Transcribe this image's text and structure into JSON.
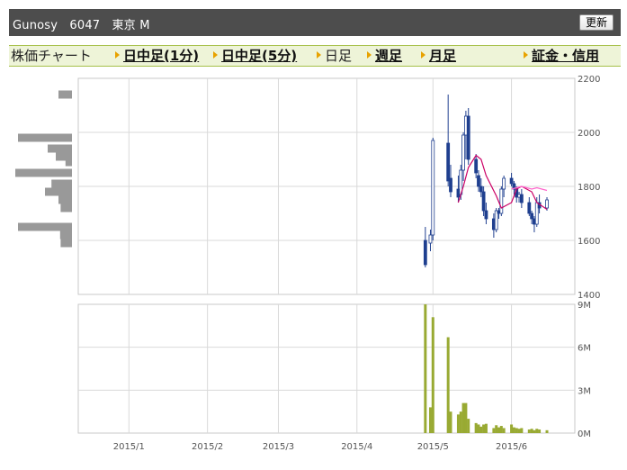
{
  "header": {
    "title": "Gunosy　6047　東京 M",
    "refresh_label": "更新"
  },
  "nav": {
    "items": [
      {
        "label": "株価チャート",
        "link": false,
        "arrow": false
      },
      {
        "label": "日中足(1分)",
        "link": true,
        "arrow": true
      },
      {
        "label": "日中足(5分)",
        "link": true,
        "arrow": true
      },
      {
        "label": "日足",
        "link": false,
        "arrow": true
      },
      {
        "label": "週足",
        "link": true,
        "arrow": true
      },
      {
        "label": "月足",
        "link": true,
        "arrow": true
      },
      {
        "label": "証金・信用",
        "link": true,
        "arrow": true
      }
    ]
  },
  "colors": {
    "up": "#ffffff",
    "down": "#1f3f8f",
    "wick": "#1f3f8f",
    "ma": "#cc0066",
    "ma2": "#ff66cc",
    "volume": "#99aa33",
    "profile": "#999999",
    "grid": "#d9d9d9"
  },
  "chart_data": [
    {
      "type": "candlestick",
      "title": "",
      "y_ticks": [
        "2200",
        "2000",
        "1800",
        "1600",
        "1400"
      ],
      "y_tick_values": [
        2200,
        2000,
        1800,
        1600,
        1400
      ],
      "ylim": [
        1400,
        2200
      ],
      "x_ticks": [
        "2015/1",
        "2015/2",
        "2015/3",
        "2015/4",
        "2015/5",
        "2015/6"
      ],
      "date_range": [
        "2014-12-12",
        "2015-06-26"
      ],
      "grid": true,
      "ohlc": [
        [
          "2015-04-28",
          1600,
          1650,
          1500,
          1510
        ],
        [
          "2015-04-30",
          1590,
          1640,
          1560,
          1620
        ],
        [
          "2015-05-01",
          1620,
          1980,
          1600,
          1970
        ],
        [
          "2015-05-07",
          1960,
          2140,
          1800,
          1820
        ],
        [
          "2015-05-08",
          1830,
          1880,
          1760,
          1780
        ],
        [
          "2015-05-11",
          1790,
          1840,
          1740,
          1760
        ],
        [
          "2015-05-12",
          1770,
          1880,
          1750,
          1860
        ],
        [
          "2015-05-13",
          1860,
          2000,
          1820,
          1990
        ],
        [
          "2015-05-14",
          1990,
          2080,
          1900,
          2060
        ],
        [
          "2015-05-15",
          2060,
          2090,
          1880,
          1900
        ],
        [
          "2015-05-18",
          1900,
          1920,
          1830,
          1850
        ],
        [
          "2015-05-19",
          1840,
          1860,
          1780,
          1800
        ],
        [
          "2015-05-20",
          1800,
          1830,
          1760,
          1780
        ],
        [
          "2015-05-21",
          1780,
          1800,
          1690,
          1710
        ],
        [
          "2015-05-22",
          1710,
          1740,
          1660,
          1680
        ],
        [
          "2015-05-25",
          1680,
          1700,
          1610,
          1640
        ],
        [
          "2015-05-26",
          1640,
          1720,
          1630,
          1710
        ],
        [
          "2015-05-27",
          1710,
          1720,
          1680,
          1700
        ],
        [
          "2015-05-28",
          1700,
          1800,
          1690,
          1790
        ],
        [
          "2015-05-29",
          1790,
          1840,
          1760,
          1830
        ],
        [
          "2015-06-01",
          1830,
          1850,
          1800,
          1810
        ],
        [
          "2015-06-02",
          1810,
          1820,
          1770,
          1790
        ],
        [
          "2015-06-03",
          1790,
          1800,
          1740,
          1760
        ],
        [
          "2015-06-04",
          1760,
          1780,
          1740,
          1770
        ],
        [
          "2015-06-05",
          1770,
          1790,
          1720,
          1740
        ],
        [
          "2015-06-08",
          1740,
          1760,
          1690,
          1700
        ],
        [
          "2015-06-09",
          1700,
          1710,
          1660,
          1680
        ],
        [
          "2015-06-10",
          1680,
          1690,
          1630,
          1660
        ],
        [
          "2015-06-11",
          1660,
          1760,
          1650,
          1740
        ],
        [
          "2015-06-12",
          1740,
          1770,
          1700,
          1720
        ],
        [
          "2015-06-15",
          1720,
          1760,
          1710,
          1750
        ]
      ],
      "moving_average_1": [
        [
          "2015-05-11",
          1740
        ],
        [
          "2015-05-13",
          1800
        ],
        [
          "2015-05-15",
          1870
        ],
        [
          "2015-05-18",
          1915
        ],
        [
          "2015-05-20",
          1900
        ],
        [
          "2015-05-22",
          1840
        ],
        [
          "2015-05-26",
          1765
        ],
        [
          "2015-05-28",
          1720
        ],
        [
          "2015-06-01",
          1740
        ],
        [
          "2015-06-03",
          1790
        ],
        [
          "2015-06-05",
          1800
        ],
        [
          "2015-06-09",
          1780
        ],
        [
          "2015-06-11",
          1740
        ],
        [
          "2015-06-15",
          1715
        ]
      ],
      "moving_average_2": [
        [
          "2015-06-01",
          1790
        ],
        [
          "2015-06-05",
          1800
        ],
        [
          "2015-06-09",
          1790
        ],
        [
          "2015-06-11",
          1795
        ],
        [
          "2015-06-15",
          1785
        ]
      ],
      "volume_by_price": [
        [
          2140,
          0.25
        ],
        [
          1980,
          1.0
        ],
        [
          1940,
          0.45
        ],
        [
          1910,
          0.3
        ],
        [
          1890,
          0.12
        ],
        [
          1850,
          1.05
        ],
        [
          1810,
          0.38
        ],
        [
          1780,
          0.5
        ],
        [
          1750,
          0.25
        ],
        [
          1720,
          0.21
        ],
        [
          1650,
          1.0
        ],
        [
          1620,
          0.22
        ],
        [
          1590,
          0.21
        ]
      ]
    },
    {
      "type": "bar",
      "title": "",
      "y_ticks": [
        "9M",
        "6M",
        "3M",
        "0M"
      ],
      "y_tick_values": [
        9,
        6,
        3,
        0
      ],
      "unit": "M",
      "ylim": [
        0,
        9
      ],
      "grid": true,
      "x_ticks": [
        "2015/1",
        "2015/2",
        "2015/3",
        "2015/4",
        "2015/5",
        "2015/6"
      ],
      "volumes": [
        [
          "2015-04-28",
          9.0
        ],
        [
          "2015-04-30",
          1.8
        ],
        [
          "2015-05-01",
          8.1
        ],
        [
          "2015-05-07",
          6.7
        ],
        [
          "2015-05-08",
          1.5
        ],
        [
          "2015-05-11",
          1.3
        ],
        [
          "2015-05-12",
          1.5
        ],
        [
          "2015-05-13",
          2.1
        ],
        [
          "2015-05-14",
          2.1
        ],
        [
          "2015-05-15",
          1.0
        ],
        [
          "2015-05-18",
          0.7
        ],
        [
          "2015-05-19",
          0.6
        ],
        [
          "2015-05-20",
          0.45
        ],
        [
          "2015-05-21",
          0.6
        ],
        [
          "2015-05-22",
          0.65
        ],
        [
          "2015-05-25",
          0.35
        ],
        [
          "2015-05-26",
          0.55
        ],
        [
          "2015-05-27",
          0.4
        ],
        [
          "2015-05-28",
          0.5
        ],
        [
          "2015-05-29",
          0.35
        ],
        [
          "2015-06-01",
          0.6
        ],
        [
          "2015-06-02",
          0.4
        ],
        [
          "2015-06-03",
          0.35
        ],
        [
          "2015-06-04",
          0.3
        ],
        [
          "2015-06-05",
          0.35
        ],
        [
          "2015-06-08",
          0.25
        ],
        [
          "2015-06-09",
          0.3
        ],
        [
          "2015-06-10",
          0.2
        ],
        [
          "2015-06-11",
          0.3
        ],
        [
          "2015-06-12",
          0.25
        ],
        [
          "2015-06-15",
          0.2
        ]
      ]
    }
  ]
}
